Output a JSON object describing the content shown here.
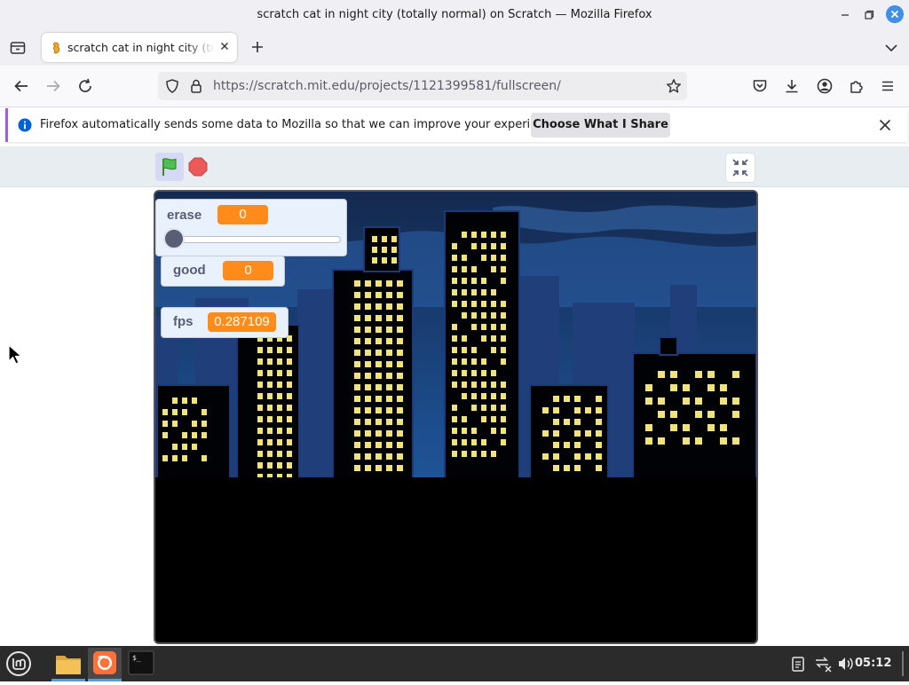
{
  "window": {
    "title": "scratch cat in night city (totally normal) on Scratch — Mozilla Firefox"
  },
  "tab": {
    "title": "scratch cat in night city (totally normal) on Scratch"
  },
  "navbar": {
    "url": "https://scratch.mit.edu/projects/1121399581/fullscreen/"
  },
  "notification": {
    "message": "Firefox automatically sends some data to Mozilla so that we can improve your experience.",
    "button_label": "Choose What I Share"
  },
  "monitors": {
    "erase": {
      "label": "erase",
      "value": "0",
      "slider_fraction": 0
    },
    "good": {
      "label": "good",
      "value": "0"
    },
    "fps": {
      "label": "fps",
      "value": "0.287109"
    }
  },
  "taskbar": {
    "clock": "05:12"
  },
  "colors": {
    "accent": "#3d8fe8",
    "monitor_value": "#ff8c1a",
    "notification_bar": "#a855f7"
  }
}
